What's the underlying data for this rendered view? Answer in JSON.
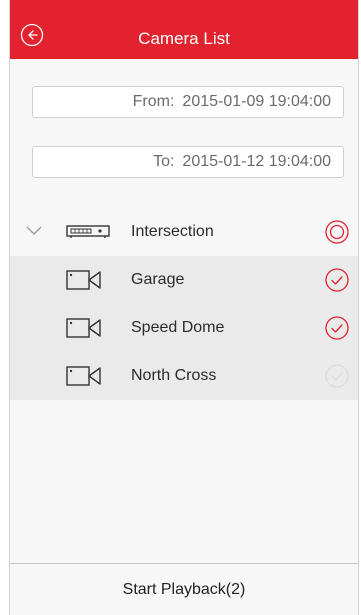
{
  "header": {
    "title": "Camera List",
    "back_icon": "back-arrow-circle-icon"
  },
  "time_range": {
    "from_label": "From:",
    "from_value": "2015-01-09 19:04:00",
    "to_label": "To:",
    "to_value": "2015-01-12 19:04:00"
  },
  "tree": {
    "group": {
      "label": "Intersection",
      "expanded": true,
      "icon": "nvr-device-icon",
      "selection": "partial"
    },
    "cameras": [
      {
        "label": "Garage",
        "selected": true,
        "icon": "camera-icon"
      },
      {
        "label": "Speed Dome",
        "selected": true,
        "icon": "camera-icon"
      },
      {
        "label": "North Cross",
        "selected": false,
        "icon": "camera-icon"
      }
    ]
  },
  "footer": {
    "playback_label": "Start Playback(2)"
  },
  "colors": {
    "accent": "#e2232f",
    "unselected": "#dcdcdc"
  }
}
